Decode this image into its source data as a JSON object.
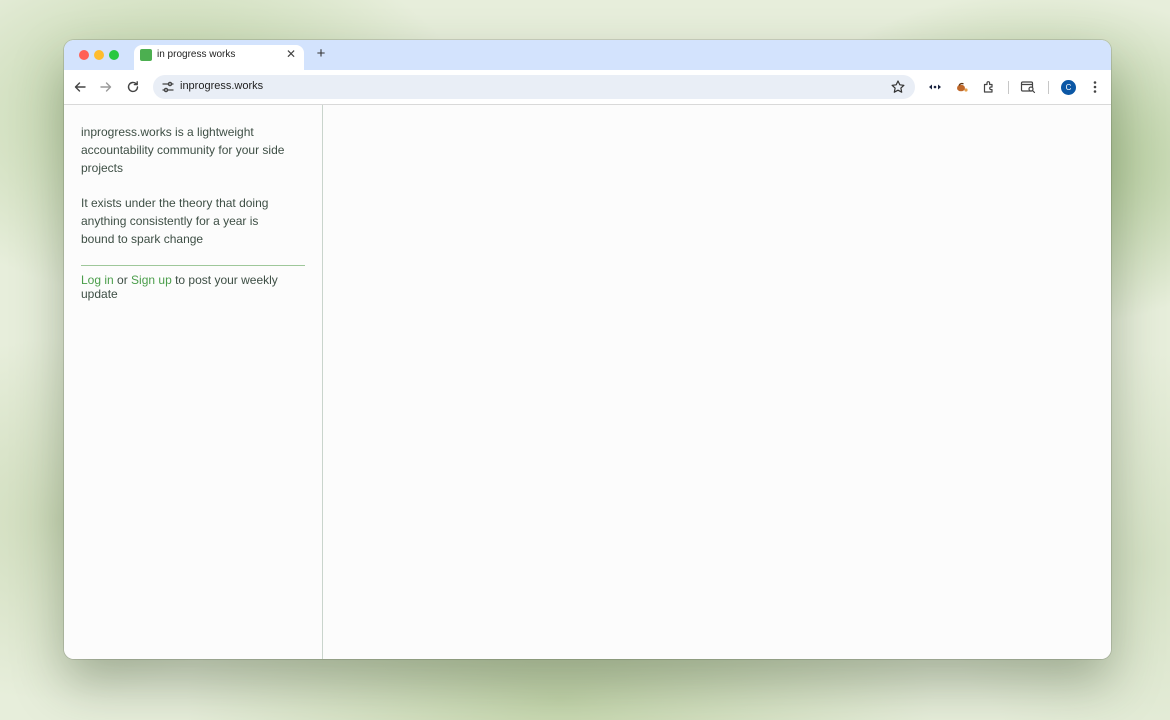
{
  "browser": {
    "tab": {
      "title": "in progress works",
      "close_glyph": "✕"
    },
    "new_tab_glyph": "+",
    "address": {
      "url": "inprogress.works"
    },
    "profile_initial": "C",
    "icons": [
      "back-icon",
      "forward-icon",
      "reload-icon",
      "site-settings-icon",
      "bookmark-star-icon",
      "extension-icon",
      "extension-icon",
      "extensions-puzzle-icon",
      "tab-search-icon",
      "more-menu-icon"
    ]
  },
  "page": {
    "intro": {
      "line_1": "inprogress.works is a lightweight accountability community for your side projects",
      "line_2": "It exists under the theory that doing anything consistently for a year is bound to spark change"
    },
    "auth": {
      "login_label": "Log in",
      "or_text": " or ",
      "signup_label": "Sign up",
      "suffix": " to post your weekly update"
    }
  },
  "colors": {
    "link": "#4a9d4a",
    "text": "#3e4f45",
    "divider": "#9ec79a",
    "tabstrip": "#d3e3fd"
  }
}
